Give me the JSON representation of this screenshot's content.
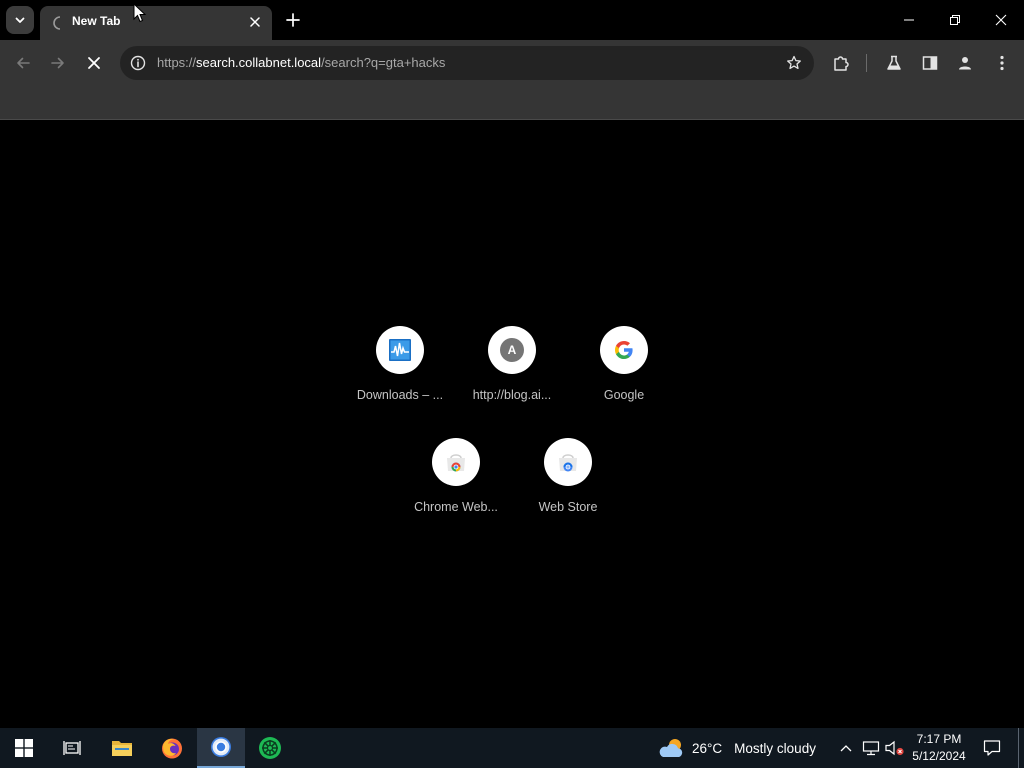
{
  "tabs": [
    {
      "title": "New Tab",
      "loading": true
    }
  ],
  "tab_search": {
    "icon": "chevron-down-icon"
  },
  "new_tab": {
    "icon": "plus-icon"
  },
  "window_controls": [
    "minimize-icon",
    "restore-icon",
    "close-icon"
  ],
  "toolbar": {
    "back_icon": "arrow-left-icon",
    "forward_icon": "arrow-right-icon",
    "stop_icon": "x-icon",
    "extensions_icon": "puzzle-icon",
    "labs_icon": "flask-icon",
    "side_panel_icon": "side-panel-icon",
    "profile_icon": "person-icon",
    "menu_icon": "kebab-icon"
  },
  "omnibox": {
    "url_scheme": "https://",
    "url_host": "search.collabnet.local",
    "url_path": "/search?q=gta+hacks",
    "info_icon": "info-icon",
    "star_icon": "star-icon"
  },
  "shortcuts": [
    {
      "label": "Downloads – ...",
      "icon": "waveform-site-icon"
    },
    {
      "label": "http://blog.ai...",
      "icon": "letter-avatar-icon",
      "letter": "A"
    },
    {
      "label": "Google",
      "icon": "google-g-icon",
      "letter": "G"
    },
    {
      "label": "Chrome Web...",
      "icon": "chrome-web-store-icon"
    },
    {
      "label": "Web Store",
      "icon": "web-store-icon"
    }
  ],
  "taskbar": {
    "apps": [
      "windows-start-icon",
      "task-view-icon",
      "file-explorer-icon",
      "firefox-icon",
      "chrome-icon",
      "green-app-icon"
    ],
    "active_app": "chrome-icon",
    "weather_temp": "26°C",
    "weather_text": "Mostly cloudy",
    "time": "7:17 PM",
    "date": "5/12/2024"
  },
  "colors": {
    "tab_active": "#353535",
    "toolbar": "#353535",
    "omnibox": "#232323",
    "taskbar": "#101820",
    "content": "#000000"
  }
}
